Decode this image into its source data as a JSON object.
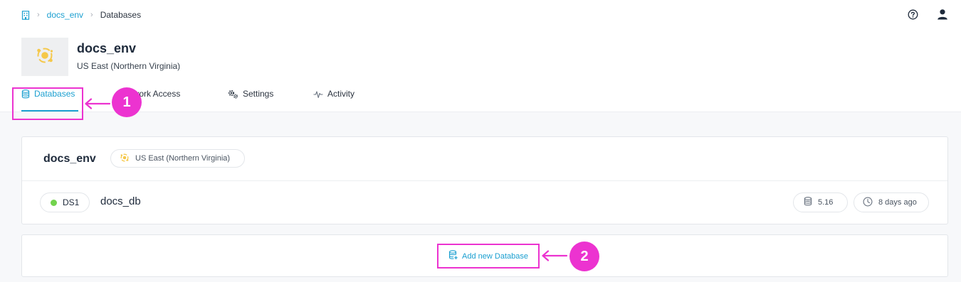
{
  "breadcrumb": {
    "home_icon": "building-icon",
    "env_link": "docs_env",
    "current": "Databases"
  },
  "header_icons": [
    "help-circle-icon",
    "user-icon"
  ],
  "environment": {
    "logo_icon": "aws-region-sun-icon",
    "title": "docs_env",
    "region": "US East (Northern Virginia)"
  },
  "tabs": [
    {
      "label": "Databases",
      "icon": "database-icon",
      "active": true
    },
    {
      "label": "Network Access",
      "icon": "network-icon",
      "active": false
    },
    {
      "label": "Settings",
      "icon": "gears-icon",
      "active": false
    },
    {
      "label": "Activity",
      "icon": "activity-icon",
      "active": false
    }
  ],
  "env_card": {
    "name": "docs_env",
    "region": "US East (Northern Virginia)",
    "database": {
      "type_badge": "DS1",
      "status_color": "#72d34d",
      "name": "docs_db",
      "version": "5.16",
      "created": "8 days ago"
    }
  },
  "add_database": {
    "label": "Add new Database",
    "icon": "database-add-icon"
  },
  "callouts": [
    "1",
    "2"
  ],
  "colors": {
    "accent": "#1b9fd0",
    "highlight": "#ec33d0",
    "status_ok": "#72d34d"
  }
}
